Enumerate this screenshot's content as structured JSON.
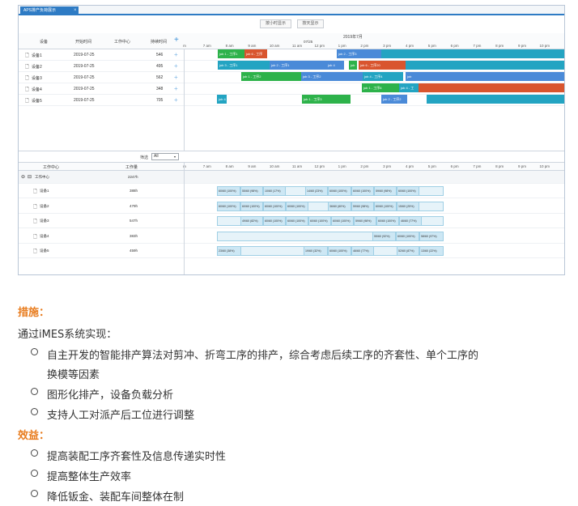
{
  "screenshot": {
    "tab_title": "APS排产负荷展示",
    "tab_close": "×",
    "buttons": {
      "hour": "按小时显示",
      "day": "按天显示"
    },
    "columns": {
      "device": "设备",
      "start": "开始时间",
      "workcenter": "工作中心",
      "duration": "持续时间",
      "add": "+"
    },
    "date_header": {
      "month": "2019年7月",
      "day": "07/25"
    },
    "time_labels": [
      "m",
      "7 am",
      "8 am",
      "9 am",
      "10 am",
      "11 am",
      "12 pm",
      "1 pm",
      "2 pm",
      "3 pm",
      "4 pm",
      "5 pm",
      "6 pm",
      "7 pm",
      "8 pm",
      "9 pm",
      "10 pm"
    ],
    "devices": [
      {
        "name": "设备1",
        "start": "2019-07-25",
        "duration": "546"
      },
      {
        "name": "设备2",
        "start": "2019-07-25",
        "duration": "495"
      },
      {
        "name": "设备3",
        "start": "2019-07-25",
        "duration": "562"
      },
      {
        "name": "设备4",
        "start": "2019-07-25",
        "duration": "348"
      },
      {
        "name": "设备5",
        "start": "2019-07-25",
        "duration": "705"
      }
    ],
    "job_labels": {
      "r1": [
        "job 1 - 工序1",
        "job 6 - 工序",
        "job 2 - 工序3"
      ],
      "r2": [
        "job 3 - 工序1",
        "job 2 - 工序1",
        "job 4",
        "job",
        "job 6 - 工序20"
      ],
      "r3": [
        "job 1 - 工序2",
        "job 3 - 工序2",
        "job 4 - 工序4",
        "job"
      ],
      "r4": [
        "job 1 - 工序6",
        "job 4 - 工"
      ],
      "r5": [
        "job 4",
        "job 1 - 工序3",
        "job 2 - 工序2"
      ]
    },
    "filter": {
      "label": "筛选",
      "value": "All",
      "arrow": "▾"
    },
    "load_columns": {
      "workcenter": "工作中心",
      "hours": "工作量"
    },
    "load_group": {
      "name": "工作中心",
      "hours": "2247h",
      "toggle": "⊖",
      "box": "⊟"
    },
    "load_rows": [
      {
        "name": "设备1",
        "hours": "388h",
        "cells": [
          "60/60 (100%)",
          "55/60 (98%)",
          "10/60 (17%)",
          "14/60 (23%)",
          "60/60 (100%)",
          "60/60 (100%)",
          "59/60 (98%)",
          "60/60 (100%)"
        ]
      },
      {
        "name": "设备2",
        "hours": "479h",
        "cells": [
          "60/60 (100%)",
          "60/60 (100%)",
          "60/60 (100%)",
          "60/60 (100%)",
          "36/60 (60%)",
          "59/60 (98%)",
          "60/60 (100%)",
          "15/60 (25%)"
        ]
      },
      {
        "name": "设备3",
        "hours": "547h",
        "cells": [
          "49/60 (82%)",
          "60/60 (100%)",
          "60/60 (100%)",
          "60/60 (100%)",
          "60/60 (100%)",
          "59/60 (98%)",
          "60/60 (100%)",
          "46/60 (77%)"
        ]
      },
      {
        "name": "设备4",
        "hours": "383h",
        "cells": [
          "55/60 (92%)",
          "60/60 (100%)",
          "58/60 (97%)"
        ]
      },
      {
        "name": "设备5",
        "hours": "459h",
        "cells": [
          "23/60 (38%)",
          "19/60 (32%)",
          "60/60 (100%)",
          "46/60 (77%)",
          "52/60 (87%)",
          "13/60 (22%)"
        ]
      }
    ]
  },
  "article": {
    "measures_title": "措施：",
    "intro": "通过iMES系统实现：",
    "measures": [
      "自主开发的智能排产算法对剪冲、折弯工序的排产，综合考虑后续工序的齐套性、单个工序的",
      "换模等因素",
      "图形化排产，设备负载分析",
      "支持人工对派产后工位进行调整"
    ],
    "benefits_title": "效益：",
    "benefits": [
      "提高装配工序齐套性及信息传递实时性",
      "提高整体生产效率",
      "降低钣金、装配车间整体在制"
    ]
  },
  "colors": {
    "accent_orange": "#e87c1e",
    "job_green": "#2db24a",
    "job_blue": "#4a8ad8",
    "job_teal": "#23a4c2",
    "job_red": "#d9552e"
  }
}
